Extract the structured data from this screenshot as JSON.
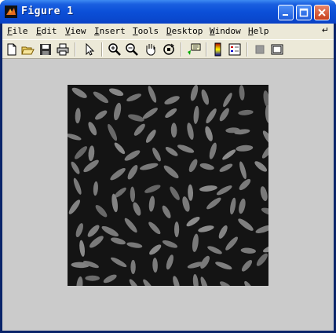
{
  "window": {
    "title": "Figure 1"
  },
  "menu": [
    "File",
    "Edit",
    "View",
    "Insert",
    "Tools",
    "Desktop",
    "Window",
    "Help"
  ],
  "menu_dock_icon": "dock-arrow-icon",
  "toolbar": {
    "tools": [
      "new-figure-icon",
      "open-file-icon",
      "save-icon",
      "print-icon",
      "edit-plot-arrow-icon",
      "zoom-in-icon",
      "zoom-out-icon",
      "pan-hand-icon",
      "rotate-3d-icon",
      "data-cursor-icon",
      "colorbar-icon",
      "legend-icon",
      "hide-plot-tools-icon",
      "show-plot-tools-icon"
    ]
  },
  "image": {
    "subject": "rice grains on dark background",
    "grain_color": "#7a7a7a",
    "background": "#141414"
  },
  "colors": {
    "title_bar": "#0b4fd8",
    "frame": "#ece9d8",
    "canvas": "#cbcbcb"
  }
}
